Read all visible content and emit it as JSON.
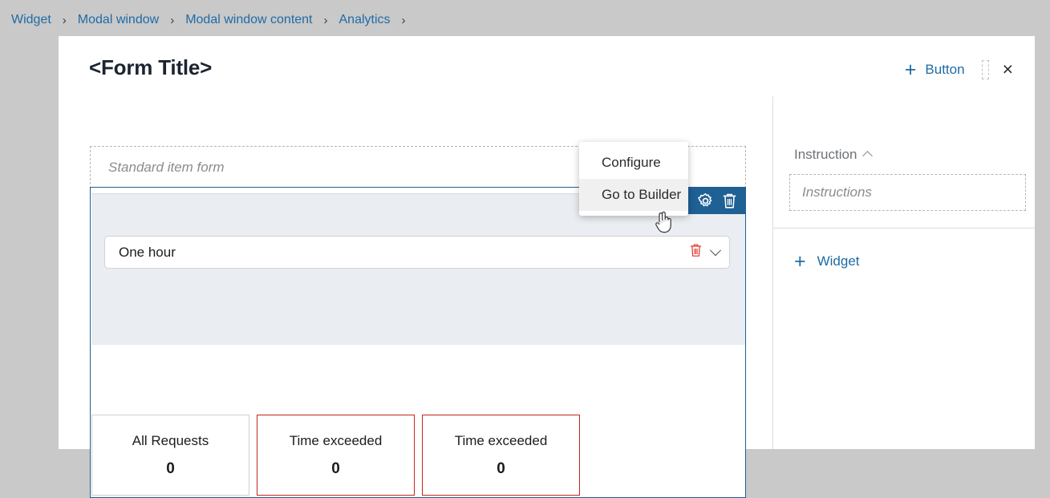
{
  "breadcrumb": {
    "items": [
      {
        "label": "Widget"
      },
      {
        "label": "Modal window"
      },
      {
        "label": "Modal window content"
      },
      {
        "label": "Analytics"
      }
    ],
    "separator": "›"
  },
  "header": {
    "title": "<Form Title>",
    "add_button_label": "Button",
    "add_icon": "plus-icon",
    "close_icon": "×"
  },
  "main": {
    "item_form_placeholder": "Standard item form",
    "toolbar": {
      "settings_icon": "gear-icon",
      "delete_icon": "trash-icon"
    },
    "select": {
      "value": "One hour",
      "delete_icon": "trash-icon",
      "expand_icon": "chevron-down-icon"
    },
    "cards": [
      {
        "title": "All Requests",
        "value": "0",
        "state": "normal"
      },
      {
        "title": "Time exceeded",
        "value": "0",
        "state": "danger"
      },
      {
        "title": "Time exceeded",
        "value": "0",
        "state": "danger"
      }
    ]
  },
  "context_menu": {
    "items": [
      {
        "label": "Configure",
        "hovered": false
      },
      {
        "label": "Go to Builder",
        "hovered": true
      }
    ]
  },
  "sidebar": {
    "instruction_title": "Instruction",
    "collapse_icon": "chevron-up-icon",
    "instructions_placeholder": "Instructions",
    "add_widget_label": "Widget",
    "add_widget_icon": "plus-icon"
  },
  "colors": {
    "link": "#1f6ba5",
    "toolbar_blue": "#1f6095",
    "danger_red": "#c0271d",
    "panel_gray_blue": "#eaedf1",
    "page_bg": "#c9c9c9"
  }
}
